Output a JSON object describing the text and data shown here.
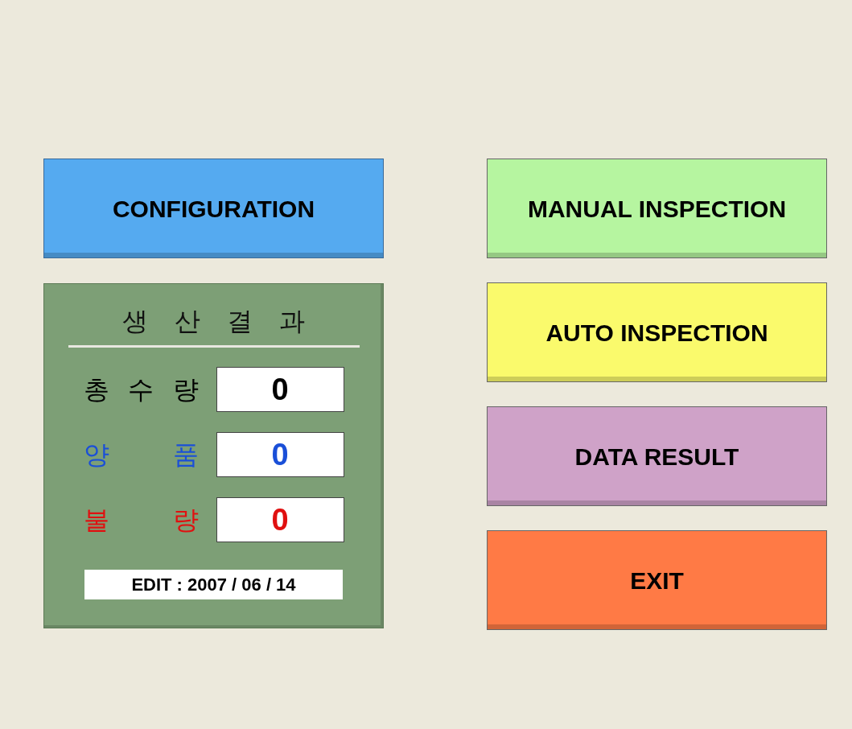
{
  "config_button": {
    "label": "CONFIGURATION",
    "color": "#55aaf0"
  },
  "production_panel": {
    "title": "생 산 결 과",
    "counters": [
      {
        "label": "총 수 량",
        "value": "0",
        "color": "#000000"
      },
      {
        "label": "양 품",
        "value": "0",
        "color": "#1a4fd8"
      },
      {
        "label": "불 량",
        "value": "0",
        "color": "#e01010"
      }
    ],
    "edit_date": "EDIT : 2007 / 06 / 14"
  },
  "buttons": [
    {
      "label": "MANUAL INSPECTION",
      "color": "#b6f5a0"
    },
    {
      "label": "AUTO INSPECTION",
      "color": "#fafa6c"
    },
    {
      "label": "DATA RESULT",
      "color": "#cfa2c8"
    },
    {
      "label": "EXIT",
      "color": "#ff7a45"
    }
  ]
}
